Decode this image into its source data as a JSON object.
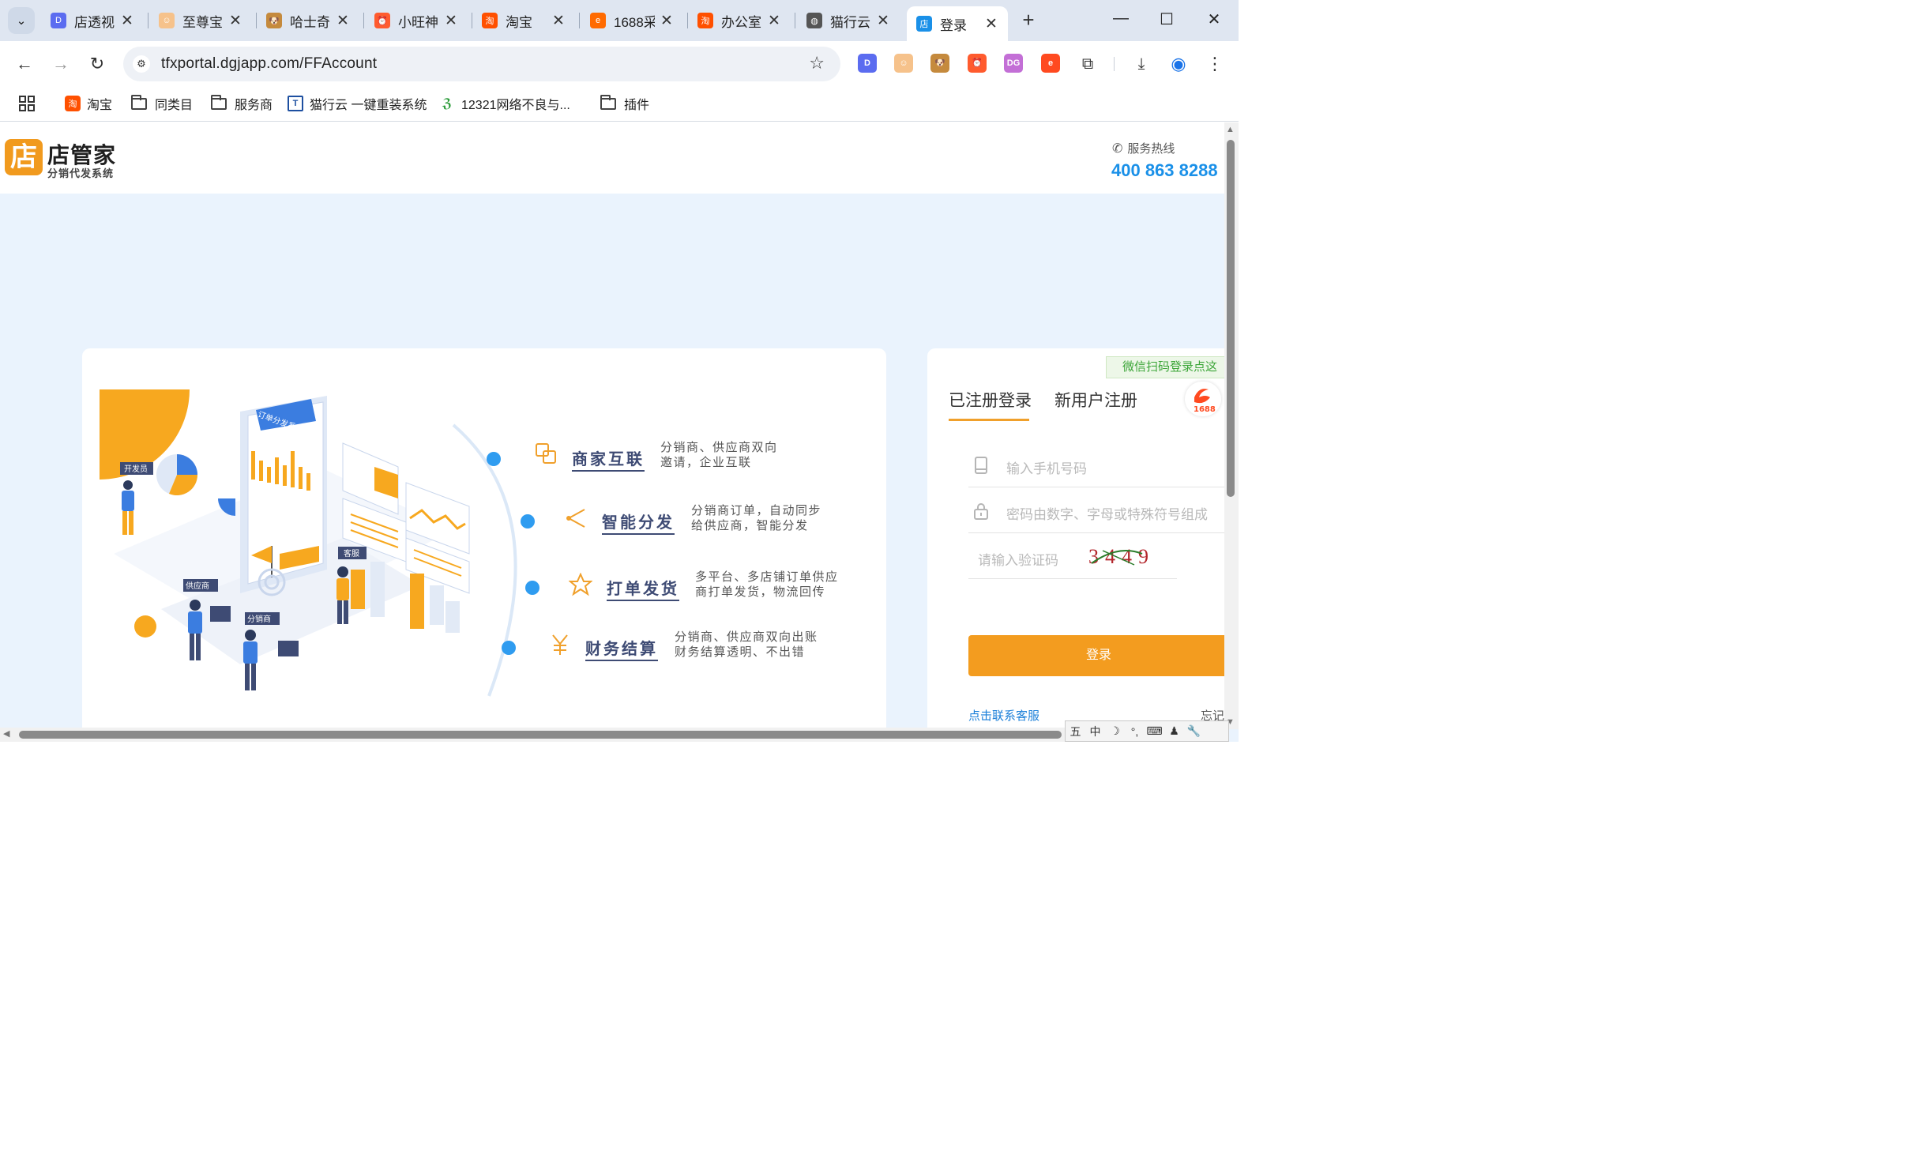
{
  "browser": {
    "tabs": [
      {
        "title": "店透视",
        "color": "#5b6cf0",
        "glyph": "D"
      },
      {
        "title": "至尊宝",
        "color": "#f6c28b",
        "glyph": "☺"
      },
      {
        "title": "哈士奇",
        "color": "#c58a3d",
        "glyph": "🐶"
      },
      {
        "title": "小旺神",
        "color": "#ff5b2e",
        "glyph": "⏰"
      },
      {
        "title": "淘宝",
        "color": "#ff5000",
        "glyph": "淘"
      },
      {
        "title": "1688采",
        "color": "#ff6a00",
        "glyph": "e"
      },
      {
        "title": "办公室",
        "color": "#ff5000",
        "glyph": "淘"
      },
      {
        "title": "猫行云",
        "color": "#555555",
        "glyph": "◍"
      },
      {
        "title": "登录",
        "color": "#1a90e8",
        "glyph": "店"
      }
    ],
    "url": "tfxportal.dgjapp.com/FFAccount",
    "bookmarks": {
      "taobao": "淘宝",
      "similar": "同类目",
      "service": "服务商",
      "maoxingyun": "猫行云 一键重装系统",
      "report": "12321网络不良与...",
      "plugins": "插件"
    },
    "extensions": [
      {
        "name": "dtoushi-ext-icon",
        "color": "#5b6cf0",
        "glyph": "D"
      },
      {
        "name": "zhizunbao-ext-icon",
        "color": "#f6c28b",
        "glyph": "☺"
      },
      {
        "name": "husky-ext-icon",
        "color": "#c58a3d",
        "glyph": "🐶"
      },
      {
        "name": "xiaowang-ext-icon",
        "color": "#ff5b2e",
        "glyph": "⏰"
      },
      {
        "name": "dg-ext-icon",
        "color": "#c36fd6",
        "glyph": "DG"
      },
      {
        "name": "1688-ext-icon",
        "color": "#ff4a20",
        "glyph": "e"
      }
    ]
  },
  "site": {
    "logo_char": "店",
    "name": "店管家",
    "subtitle": "分销代发系统",
    "hotline_label": "服务热线",
    "hotline": "400 863 8288"
  },
  "features": [
    {
      "title": "商家互联",
      "desc1": "分销商、供应商双向",
      "desc2": "邀请，企业互联",
      "icon": "link-icon"
    },
    {
      "title": "智能分发",
      "desc1": "分销商订单，自动同步",
      "desc2": "给供应商，智能分发",
      "icon": "share-icon"
    },
    {
      "title": "打单发货",
      "desc1": "多平台、多店铺订单供应",
      "desc2": "商打单发货，物流回传",
      "icon": "star-icon"
    },
    {
      "title": "财务结算",
      "desc1": "分销商、供应商双向出账",
      "desc2": "财务结算透明、不出错",
      "icon": "yen-icon"
    }
  ],
  "illustration": {
    "board_label": "订单分发系统",
    "role_developer": "开发员",
    "role_supplier": "供应商",
    "role_distributor": "分销商",
    "role_service": "客服"
  },
  "login": {
    "wechat_tag": "微信扫码登录点这",
    "tab_login": "已注册登录",
    "tab_register": "新用户注册",
    "phone_placeholder": "输入手机号码",
    "password_placeholder": "密码由数字、字母或特殊符号组成",
    "captcha_placeholder": "请输入验证码",
    "captcha_text": "3449",
    "button": "登录",
    "contact": "点击联系客服",
    "forgot": "忘记"
  },
  "ime": [
    "五",
    "中",
    "☽",
    "°,",
    "⌨",
    "♟",
    "🔧"
  ]
}
